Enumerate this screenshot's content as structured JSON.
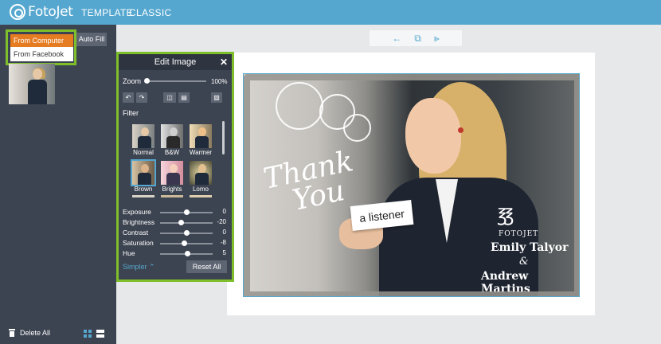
{
  "app": {
    "logo_text": "FotoJet"
  },
  "nav": {
    "tabs": [
      {
        "label": "TEMPLATE"
      },
      {
        "label": "CLASSIC"
      }
    ]
  },
  "sidebar": {
    "from_computer": "From Computer",
    "from_facebook": "From Facebook",
    "auto_fill": "Auto Fill",
    "delete_all": "Delete All"
  },
  "edit_image": {
    "title": "Edit Image",
    "close": "✕",
    "zoom": {
      "label": "Zoom",
      "value": "100%",
      "level": 0
    },
    "filter_label": "Filter",
    "filters": [
      {
        "label": "Normal"
      },
      {
        "label": "B&W"
      },
      {
        "label": "Warmer"
      },
      {
        "label": "Brown"
      },
      {
        "label": "Brights"
      },
      {
        "label": "Lomo"
      }
    ],
    "selected_filter": "Brown",
    "adjustments": [
      {
        "label": "Exposure",
        "value": "0",
        "level": 0.5
      },
      {
        "label": "Brightness",
        "value": "-20",
        "level": 0.4
      },
      {
        "label": "Contrast",
        "value": "0",
        "level": 0.5
      },
      {
        "label": "Saturation",
        "value": "-8",
        "level": 0.46
      },
      {
        "label": "Hue",
        "value": "5",
        "level": 0.52
      }
    ],
    "simpler": "Simpler",
    "reset_all": "Reset All"
  },
  "canvas": {
    "card_text": "a listener",
    "thank_you_line1": "Thank",
    "thank_you_line2": "You",
    "brand_mark": "FOTOJET",
    "name1": "Emily Talyor",
    "amp": "&",
    "name2": "Andrew Martins"
  },
  "colors": {
    "topbar": "#55a7cf",
    "sidebar": "#3d4451",
    "accent_orange": "#e57c22",
    "highlight_green": "#7ebf2b"
  }
}
